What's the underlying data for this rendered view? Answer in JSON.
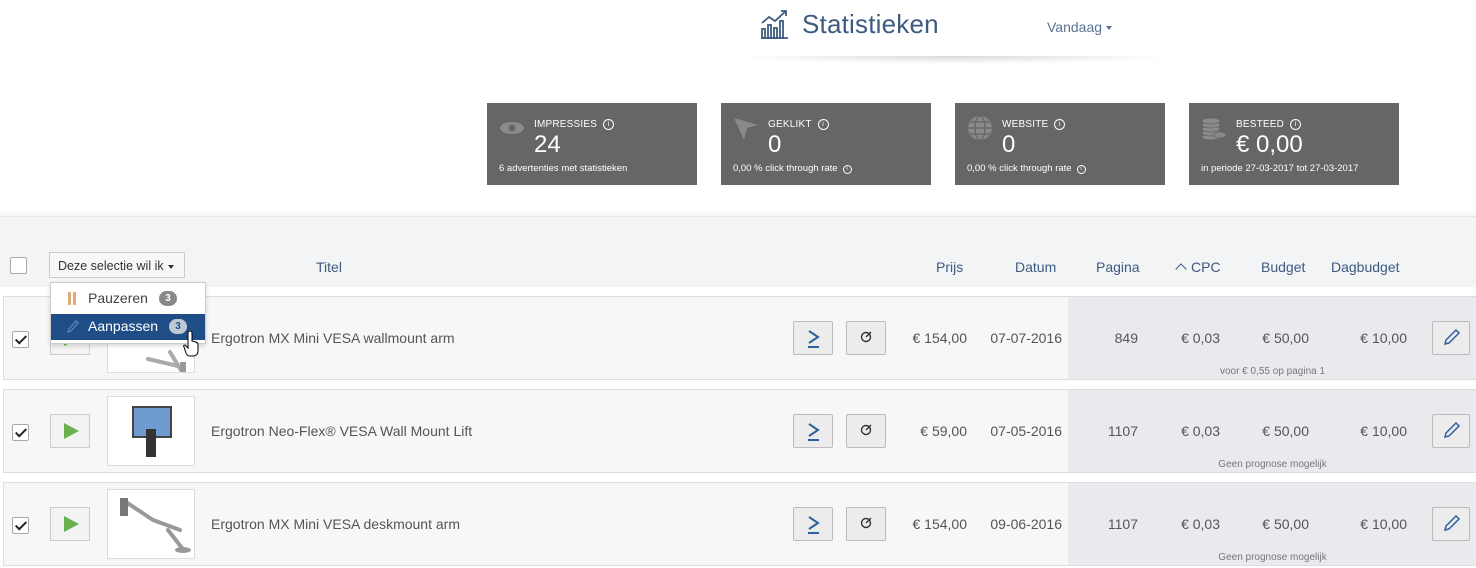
{
  "header": {
    "title": "Statistieken",
    "period": "Vandaag"
  },
  "stats": [
    {
      "label": "IMPRESSIES",
      "value": "24",
      "sub": "6 advertenties met statistieken"
    },
    {
      "label": "GEKLIKT",
      "value": "0",
      "sub_pct": "0,00 %",
      "sub": "click through rate"
    },
    {
      "label": "WEBSITE",
      "value": "0",
      "sub_pct": "0,00 %",
      "sub": "click through rate"
    },
    {
      "label": "BESTEED",
      "value": "€ 0,00",
      "sub": "in periode 27-03-2017 tot 27-03-2017"
    }
  ],
  "table": {
    "selection_button": "Deze selectie wil ik",
    "columns": {
      "title": "Titel",
      "price": "Prijs",
      "date": "Datum",
      "page": "Pagina",
      "cpc": "CPC",
      "budget": "Budget",
      "daybudget": "Dagbudget"
    },
    "menu": [
      {
        "label": "Pauzeren",
        "count": "3"
      },
      {
        "label": "Aanpassen",
        "count": "3"
      }
    ],
    "rows": [
      {
        "title": "Ergotron MX Mini VESA wallmount arm",
        "price": "€ 154,00",
        "date": "07-07-2016",
        "page": "849",
        "cpc": "€ 0,03",
        "budget": "€ 50,00",
        "daybudget": "€ 10,00",
        "forecast": "voor € 0,55 op pagina 1"
      },
      {
        "title": "Ergotron Neo-Flex® VESA Wall Mount Lift",
        "price": "€ 59,00",
        "date": "07-05-2016",
        "page": "1107",
        "cpc": "€ 0,03",
        "budget": "€ 50,00",
        "daybudget": "€ 10,00",
        "forecast": "Geen prognose mogelijk"
      },
      {
        "title": "Ergotron MX Mini VESA deskmount arm",
        "price": "€ 154,00",
        "date": "09-06-2016",
        "page": "1107",
        "cpc": "€ 0,03",
        "budget": "€ 50,00",
        "daybudget": "€ 10,00",
        "forecast": "Geen prognose mogelijk"
      }
    ]
  },
  "colors": {
    "accent": "#3d5a80",
    "card": "#666666",
    "menu_active": "#1f4e86",
    "play": "#6bb24e"
  }
}
